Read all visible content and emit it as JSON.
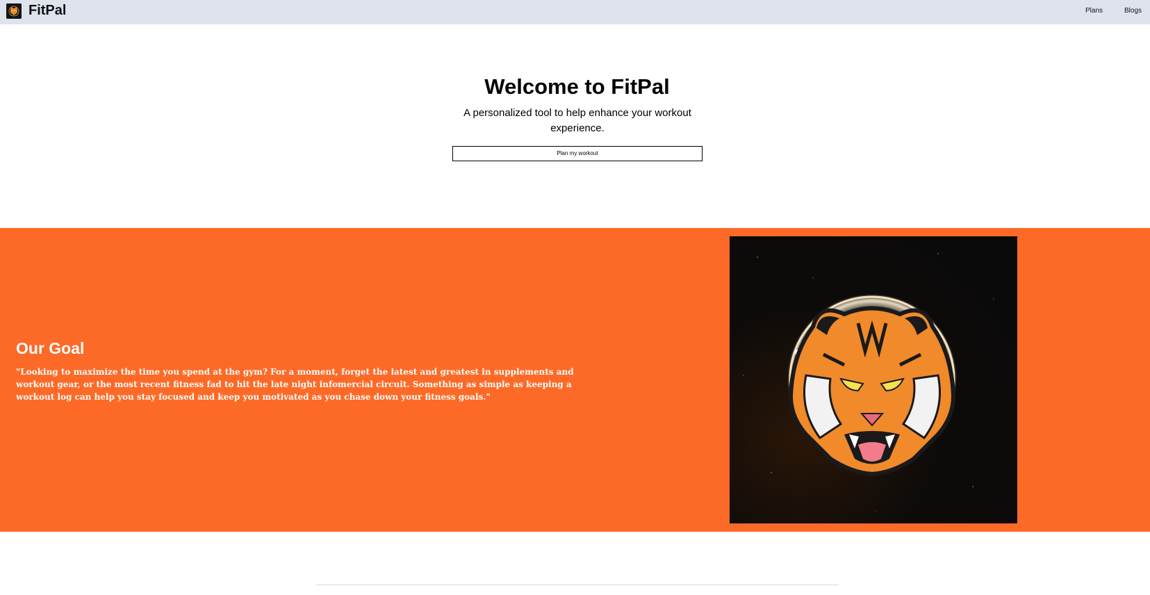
{
  "navbar": {
    "brand": "FitPal",
    "links": [
      {
        "label": "Plans"
      },
      {
        "label": "Blogs"
      }
    ]
  },
  "hero": {
    "title": "Welcome to FitPal",
    "subtitle": "A personalized tool to help enhance your workout experience.",
    "button_label": "Plan my workout"
  },
  "goal": {
    "title": "Our Goal",
    "text": "\"Looking to maximize the time you spend at the gym? For a moment, forget the latest and greatest in supplements and workout gear, or the most recent fitness fad to hit the late night infomercial circuit. Something as simple as keeping a workout log can help you stay focused and keep you motivated as you chase down your fitness goals.\"",
    "image_icon": "tiger-mascot-icon"
  },
  "colors": {
    "navbar_bg": "#dee3ee",
    "accent": "#fd6a27",
    "text": "#000000",
    "goal_text": "#ffffff"
  }
}
